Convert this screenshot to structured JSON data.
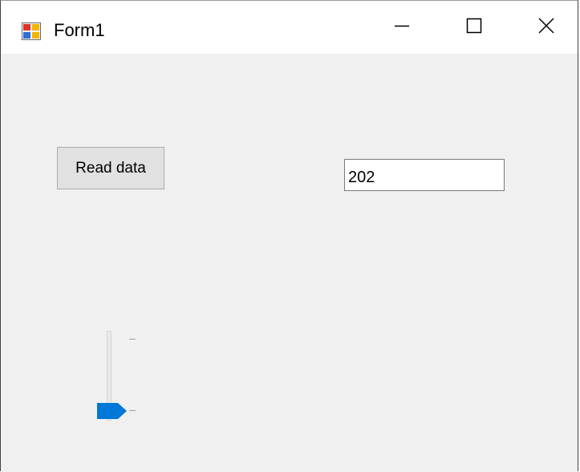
{
  "window": {
    "title": "Form1",
    "icon": "winforms-app-icon",
    "controls": {
      "minimize_icon": "minimize-icon",
      "maximize_icon": "maximize-icon",
      "close_icon": "close-icon"
    }
  },
  "form": {
    "read_button_label": "Read data",
    "textbox_value": "202",
    "trackbar": {
      "orientation": "vertical",
      "value_fraction": 1.0
    }
  },
  "colors": {
    "form_background": "#f0f0f0",
    "titlebar_background": "#ffffff",
    "accent": "#0078d7",
    "button_face": "#e1e1e1"
  }
}
